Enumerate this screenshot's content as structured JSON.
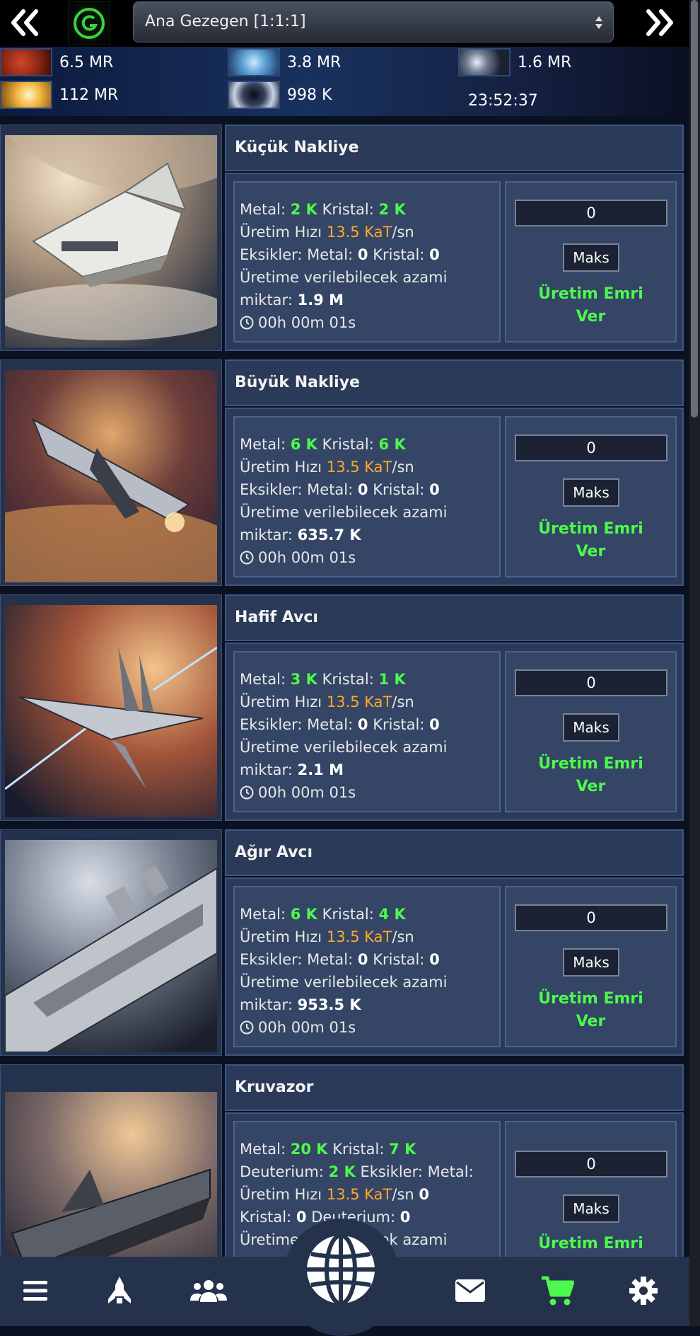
{
  "header": {
    "planet_name": "Ana Gezegen [1:1:1]",
    "prev_icon": "double-chevron-left",
    "next_icon": "double-chevron-right"
  },
  "resources": {
    "metal": "6.5 MR",
    "crystal": "3.8 MR",
    "deuterium": "1.6 MR",
    "energy": "112 MR",
    "dark_matter": "998 K",
    "clock": "23:52:37"
  },
  "labels": {
    "metal": "Metal:",
    "crystal": "Kristal:",
    "deuterium": "Deuterium:",
    "speed": "Üretim Hızı",
    "speed_unit": "/sn",
    "missing": "Eksikler:",
    "max_prod": "Üretime verilebilecek azami",
    "amount": "miktar:",
    "maks": "Maks",
    "order_line1": "Üretim Emri",
    "order_line2": "Ver"
  },
  "ships": [
    {
      "name": "Küçük Nakliye",
      "metal": "2 K",
      "crystal": "2 K",
      "speed": "13.5 KaT",
      "missing_metal": "0",
      "missing_crystal": "0",
      "max": "1.9 M",
      "time": "00h 00m 01s",
      "qty": "0"
    },
    {
      "name": "Büyük Nakliye",
      "metal": "6 K",
      "crystal": "6 K",
      "speed": "13.5 KaT",
      "missing_metal": "0",
      "missing_crystal": "0",
      "max": "635.7 K",
      "time": "00h 00m 01s",
      "qty": "0"
    },
    {
      "name": "Hafif Avcı",
      "metal": "3 K",
      "crystal": "1 K",
      "speed": "13.5 KaT",
      "missing_metal": "0",
      "missing_crystal": "0",
      "max": "2.1 M",
      "time": "00h 00m 01s",
      "qty": "0"
    },
    {
      "name": "Ağır Avcı",
      "metal": "6 K",
      "crystal": "4 K",
      "speed": "13.5 KaT",
      "missing_metal": "0",
      "missing_crystal": "0",
      "max": "953.5 K",
      "time": "00h 00m 01s",
      "qty": "0"
    },
    {
      "name": "Kruvazor",
      "metal": "20 K",
      "crystal": "7 K",
      "deuterium": "2 K",
      "speed": "13.5 KaT",
      "missing_metal": "0",
      "missing_crystal": "0",
      "missing_deuterium": "0",
      "qty": "0"
    }
  ],
  "bottom_nav": {
    "items": [
      "menu-icon",
      "fleet-icon",
      "alliance-icon",
      "galaxy-globe-icon",
      "messages-icon",
      "shop-cart-icon",
      "settings-icon"
    ],
    "active_color": "#4cf94c"
  },
  "colors": {
    "accent_green": "#4cf94c",
    "accent_orange": "#ffa92b",
    "panel": "#2b3a58"
  }
}
